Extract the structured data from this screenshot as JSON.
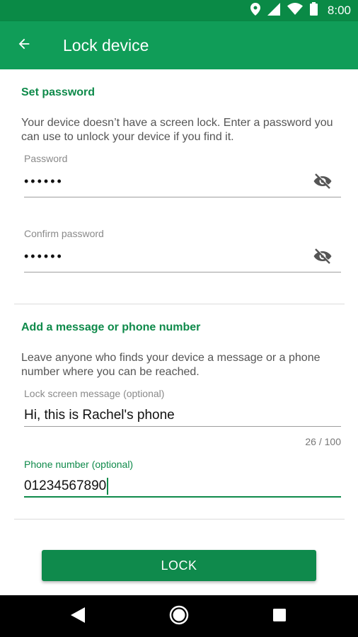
{
  "status_bar": {
    "time": "8:00",
    "icons": [
      "location-icon",
      "signal-icon",
      "wifi-icon",
      "battery-icon"
    ]
  },
  "app_bar": {
    "title": "Lock device",
    "back_icon": "arrow-back-icon"
  },
  "password_section": {
    "title": "Set password",
    "description": "Your device doesn’t have a screen lock. Enter a password you can use to unlock your device if you find it.",
    "password": {
      "label": "Password",
      "masked_value": "••••••",
      "toggle_icon": "visibility-off-icon"
    },
    "confirm_password": {
      "label": "Confirm password",
      "masked_value": "••••••",
      "toggle_icon": "visibility-off-icon"
    }
  },
  "message_section": {
    "title": "Add a message or phone number",
    "description": "Leave anyone who finds your device a message or a phone number where you can be reached.",
    "lock_message": {
      "label": "Lock screen message (optional)",
      "value": "Hi, this is Rachel's phone",
      "counter": "26 / 100"
    },
    "phone_number": {
      "label": "Phone number (optional)",
      "value": "01234567890"
    }
  },
  "lock_button": {
    "label": "LOCK"
  },
  "colors": {
    "status_bar": "#0a8a46",
    "app_bar": "#109d58",
    "accent": "#0e8a4a",
    "button": "#0f8a4c"
  },
  "nav_bar": {
    "icons": [
      "back-triangle-icon",
      "home-circle-icon",
      "recents-square-icon"
    ]
  }
}
